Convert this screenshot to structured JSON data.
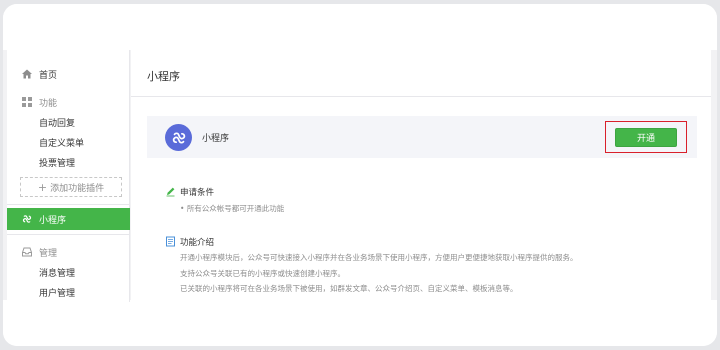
{
  "sidebar": {
    "home": "首页",
    "function_group": "功能",
    "function_items": [
      "自动回复",
      "自定义菜单",
      "投票管理"
    ],
    "add_plugin": "添加功能插件",
    "mini_program": "小程序",
    "manage_group": "管理",
    "manage_items": [
      "消息管理",
      "用户管理"
    ]
  },
  "main": {
    "title": "小程序",
    "card_name": "小程序",
    "open_button": "开通",
    "conditions_title": "申请条件",
    "conditions_items": [
      "所有公众帐号都可开通此功能"
    ],
    "intro_title": "功能介绍",
    "intro_lines": [
      "开通小程序模块后，公众号可快速接入小程序并在各业务场景下使用小程序，方便用户更便捷地获取小程序提供的服务。",
      "支持公众号关联已有的小程序或快速创建小程序。",
      "已关联的小程序将可在各业务场景下被使用，如群发文章、公众号介绍页、自定义菜单、模板消息等。"
    ]
  },
  "colors": {
    "accent_green": "#44b549",
    "highlight_red": "#d9202b",
    "logo_blue": "#5a6bd9"
  },
  "icons": [
    "home-icon",
    "grid-icon",
    "mini-program-icon",
    "inbox-icon",
    "pencil-icon",
    "document-icon"
  ]
}
